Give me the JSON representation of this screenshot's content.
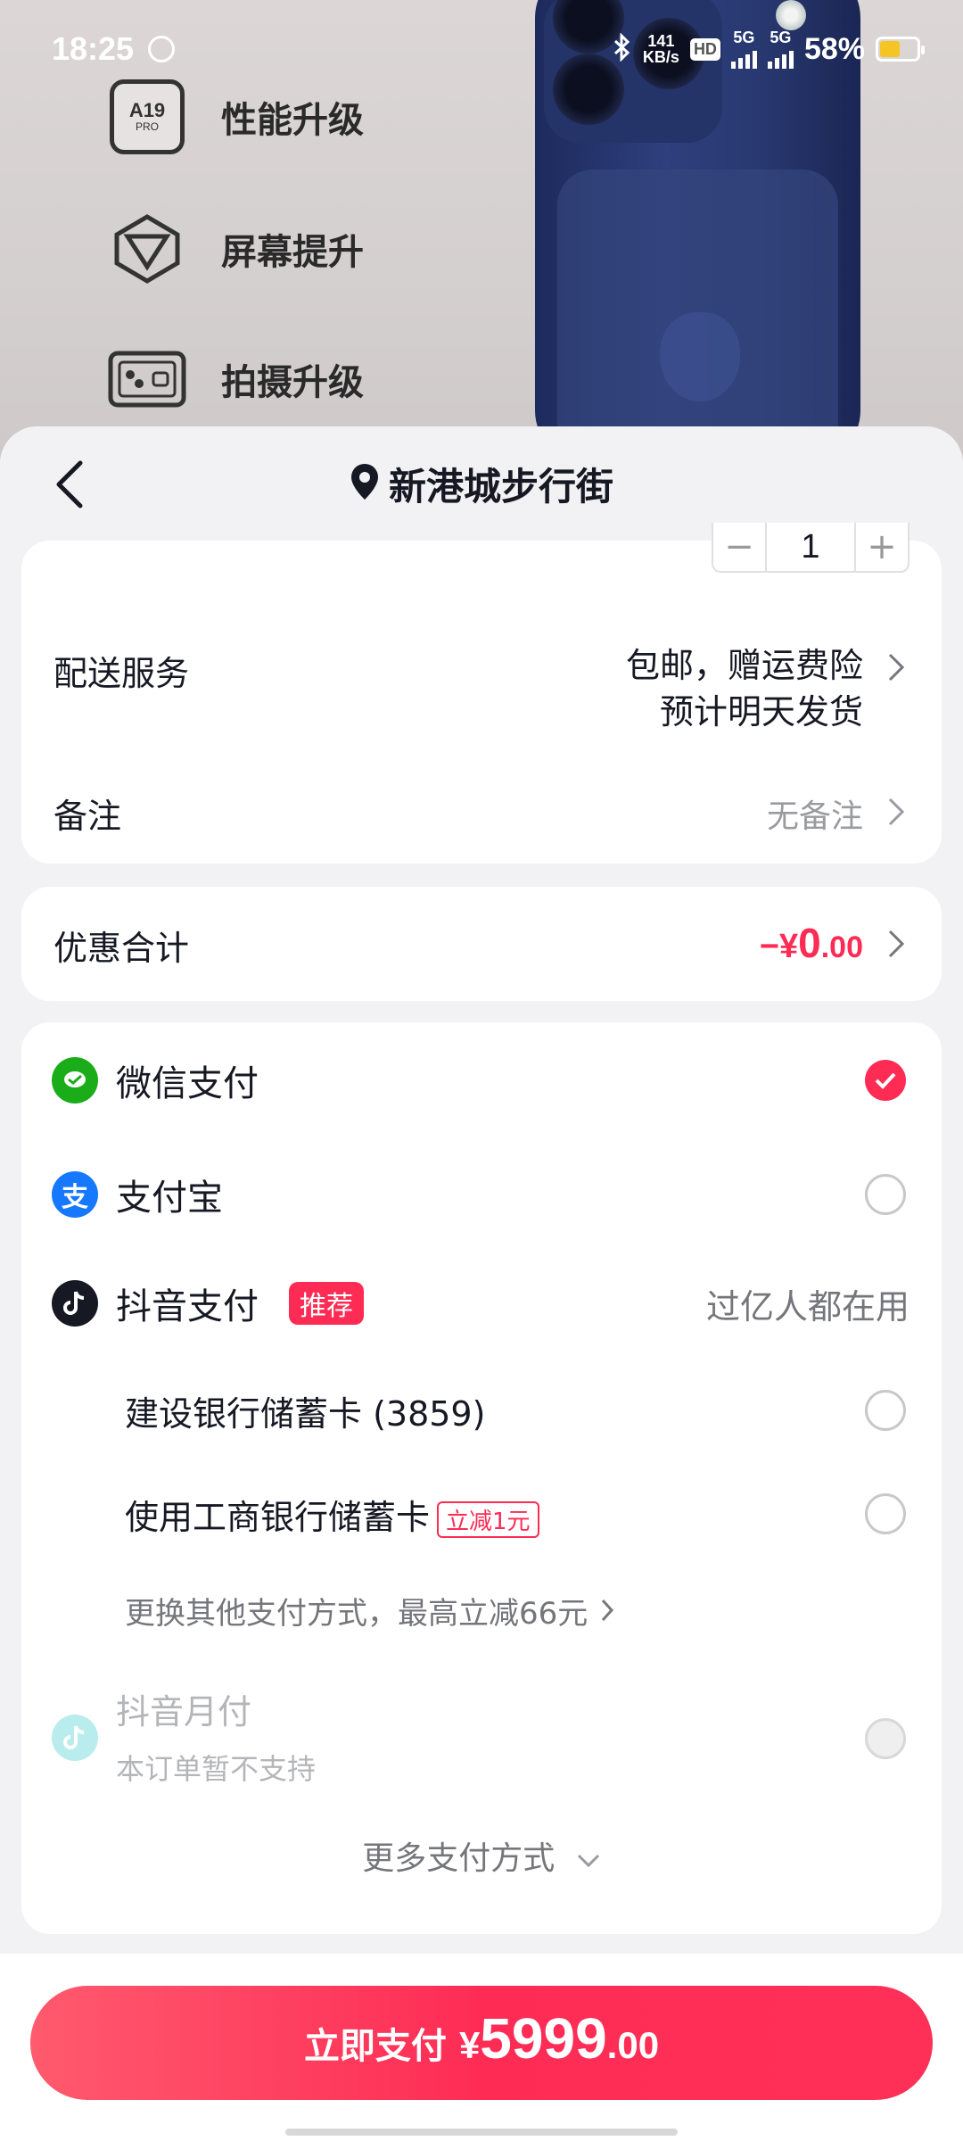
{
  "status_bar": {
    "time": "18:25",
    "net_speed_top": "141",
    "net_speed_bottom": "KB/s",
    "hd_label": "HD",
    "signal_5g_1": "5G",
    "signal_5g_2": "5G",
    "battery_percent": "58%"
  },
  "banner": {
    "features": [
      {
        "icon": "chip-icon",
        "chip_line1": "A19",
        "chip_line2": "PRO",
        "label": "性能升级"
      },
      {
        "icon": "screen-icon",
        "label": "屏幕提升"
      },
      {
        "icon": "camera-icon",
        "label": "拍摄升级"
      }
    ]
  },
  "header": {
    "back_icon": "back-arrow-icon",
    "location_icon": "location-pin-icon",
    "title": "新港城步行街"
  },
  "order": {
    "quantity": "1",
    "minus": "−",
    "plus": "+",
    "shipping_label": "配送服务",
    "shipping_value_line1": "包邮，赠运费险",
    "shipping_value_line2": "预计明天发货",
    "note_label": "备注",
    "note_value": "无备注"
  },
  "discount": {
    "label": "优惠合计",
    "sign": "−¥",
    "int": "0",
    "dec": ".00"
  },
  "payment": {
    "wechat": {
      "label": "微信支付",
      "icon": "wechat-pay-icon",
      "selected": true
    },
    "alipay": {
      "label": "支付宝",
      "icon": "alipay-icon",
      "selected": false
    },
    "douyin": {
      "label": "抖音支付",
      "icon": "douyin-icon",
      "tag": "推荐",
      "usage": "过亿人都在用"
    },
    "ccb_card": {
      "label": "建设银行储蓄卡 (3859)",
      "selected": false
    },
    "icbc_card": {
      "label": "使用工商银行储蓄卡",
      "tag": "立减1元",
      "selected": false
    },
    "switch_link": "更换其他支付方式，最高立减66元",
    "monthly": {
      "label": "抖音月付",
      "sub": "本订单暂不支持",
      "icon": "douyin-monthly-icon"
    },
    "more": "更多支付方式"
  },
  "bottom": {
    "pay_label": "立即支付",
    "currency": "¥",
    "amount_int": "5999",
    "amount_dec": ".00"
  },
  "colors": {
    "accent": "#fe2c55",
    "wechat": "#1aad19",
    "alipay": "#1677ff"
  }
}
